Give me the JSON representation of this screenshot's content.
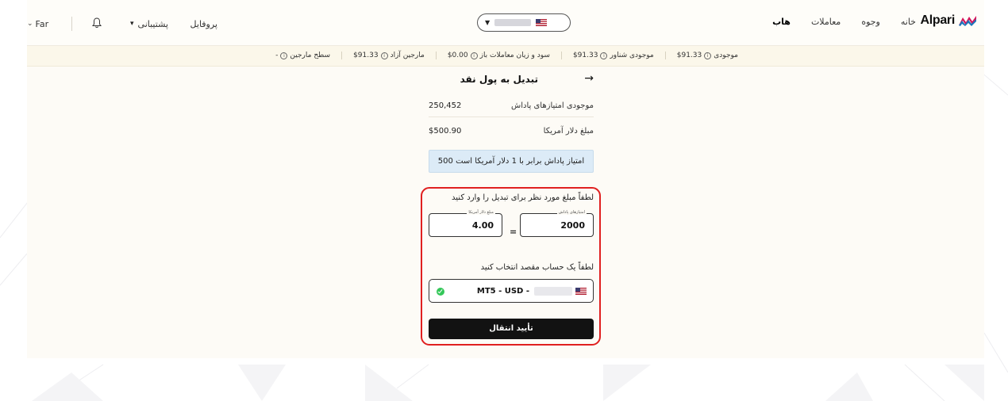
{
  "header": {
    "logo_text": "Alpari",
    "nav": [
      {
        "label": "خانه"
      },
      {
        "label": "وجوه"
      },
      {
        "label": "معاملات"
      },
      {
        "label": "هاب"
      }
    ],
    "profile_label": "پروفایل",
    "support_label": "پشتیبانی",
    "language_label": "Far"
  },
  "stats": [
    {
      "label": "موجودی",
      "value": "$91.33"
    },
    {
      "label": "موجودی شناور",
      "value": "$91.33"
    },
    {
      "label": "سود و زیان معاملات باز",
      "value": "$0.00"
    },
    {
      "label": "مارجین آزاد",
      "value": "$91.33"
    },
    {
      "label": "سطح مارجین",
      "value": "-"
    }
  ],
  "page": {
    "title": "تبدیل به پول نقد",
    "bonus_balance_label": "موجودی امتیازهای پاداش",
    "bonus_balance_value": "250,452",
    "usd_amount_label": "مبلغ دلار آمریکا",
    "usd_amount_value": "$500.90",
    "rate_info": "500 امتیاز پاداش برابر با 1 دلار آمریکا است"
  },
  "form": {
    "amount_prompt": "لطفاً مبلغ مورد نظر برای تبدیل را وارد کنید",
    "points_label": "امتیازهای پاداش",
    "points_value": "2000",
    "equals": "=",
    "usd_label": "مبلغ دلار آمریکا",
    "usd_value": "4.00",
    "account_prompt": "لطفاً یک حساب مقصد انتخاب کنید",
    "account_text": "MT5 - USD -",
    "confirm_label": "تأیید انتقال"
  },
  "colors": {
    "highlight": "#e02020",
    "confirm_bg": "#121212",
    "info_bg": "#dcebf7",
    "check": "#34c759"
  }
}
